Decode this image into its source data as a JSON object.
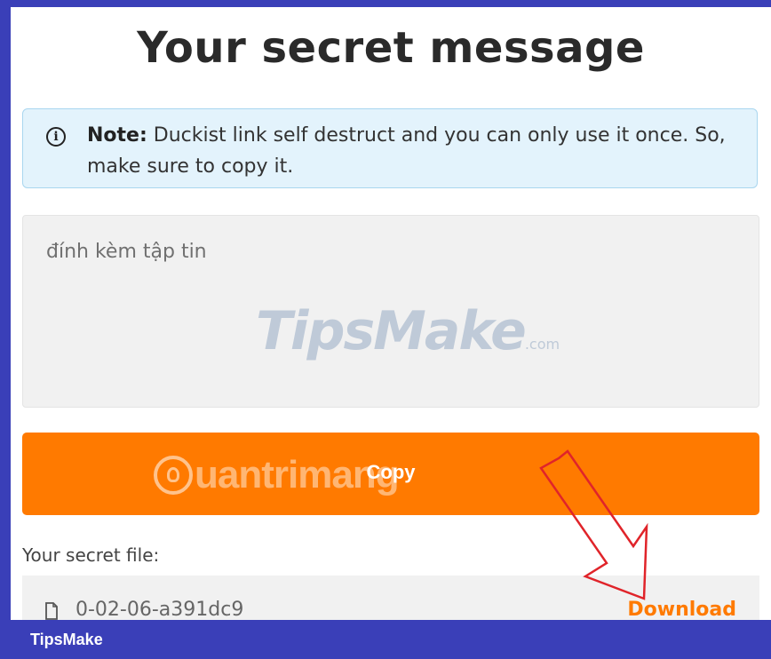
{
  "page": {
    "title": "Your secret message"
  },
  "note": {
    "icon": "info-icon",
    "bold": "Note:",
    "text": " Duckist link self destruct and you can only use it once. So, make sure to copy it."
  },
  "attachment": {
    "text": "đính kèm tập tin"
  },
  "watermarks": {
    "tipsmake": "TipsMake",
    "tipsmake_suffix": ".com",
    "quantrimang": "uantrimang"
  },
  "copy_button": {
    "label": "Copy",
    "color": "#ff7a00"
  },
  "secret_file": {
    "label": "Your secret file:",
    "file_name": "0-02-06-a391dc9",
    "file_icon": "file-icon",
    "download_label": "Download"
  },
  "footer": {
    "brand": "TipsMake"
  },
  "colors": {
    "accent": "#ff7a00",
    "frame": "#3a3fb8",
    "note_bg": "#e3f3fc",
    "arrow": "#e0242a"
  }
}
